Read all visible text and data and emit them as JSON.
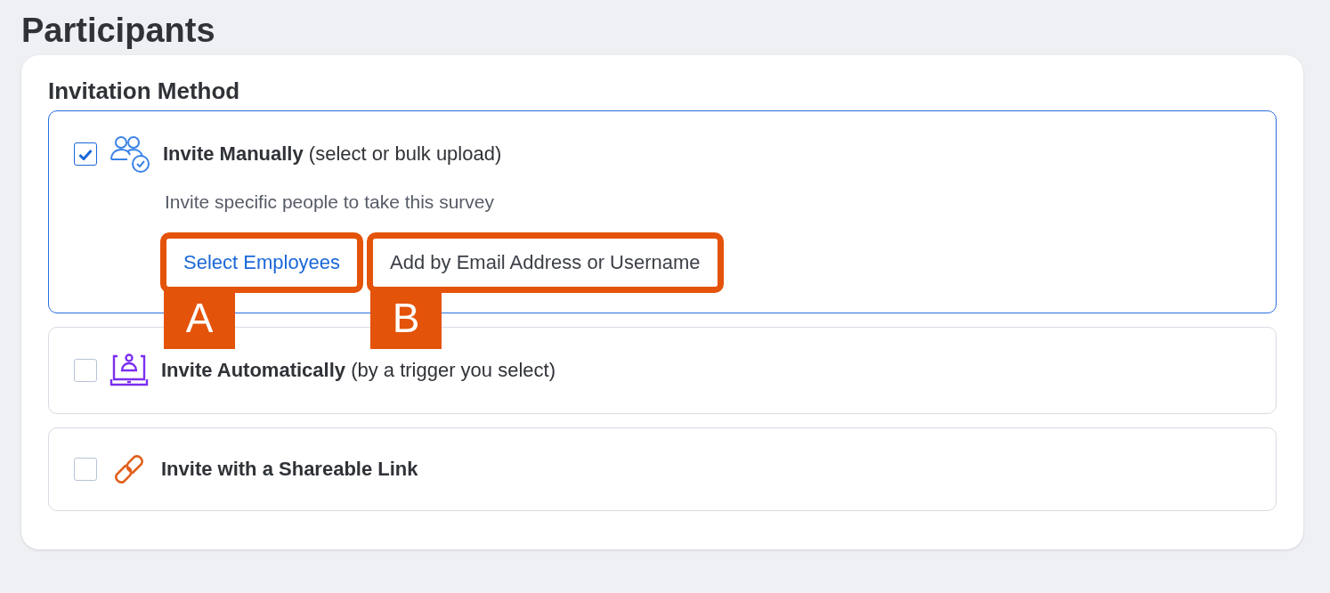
{
  "page_title": "Participants",
  "section_title": "Invitation Method",
  "options": [
    {
      "kind": "people",
      "title": "Invite Manually",
      "note": "(select or bulk upload)",
      "checked": true,
      "description": "Invite specific people to take this survey",
      "buttons": [
        {
          "label": "Select Employees",
          "kind": "link",
          "callout": "A"
        },
        {
          "label": "Add by Email Address or Username",
          "kind": "plain",
          "callout": "B"
        }
      ]
    },
    {
      "kind": "laptop",
      "title": "Invite Automatically",
      "note": "(by a trigger you select)",
      "checked": false
    },
    {
      "kind": "link",
      "title": "Invite with a Shareable Link",
      "checked": false
    }
  ]
}
